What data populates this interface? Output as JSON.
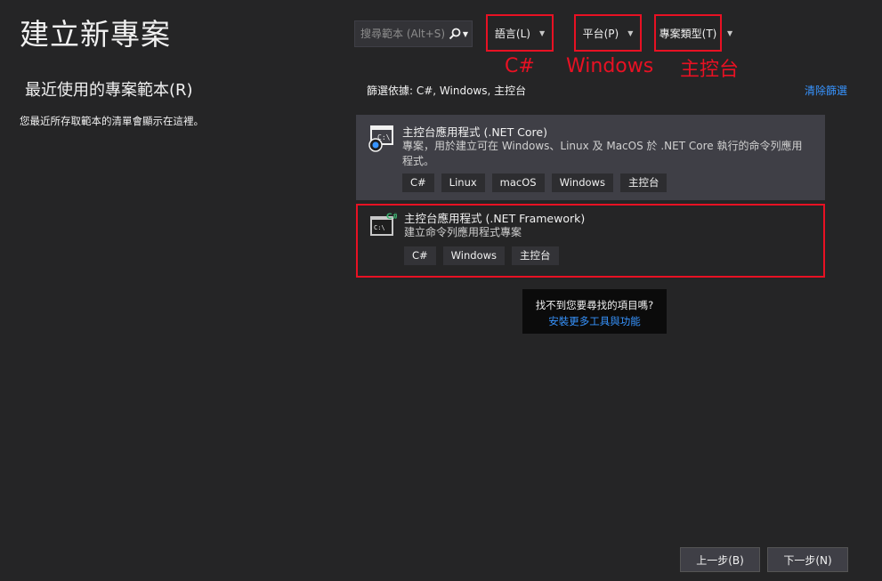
{
  "header": {
    "title": "建立新專案"
  },
  "recent": {
    "title": "最近使用的專案範本(R)",
    "empty_message": "您最近所存取範本的清單會顯示在這裡。"
  },
  "search": {
    "placeholder": "搜尋範本 (Alt+S)"
  },
  "filters": {
    "language": {
      "label": "語言(L)",
      "annotation": "C#"
    },
    "platform": {
      "label": "平台(P)",
      "annotation": "Windows"
    },
    "project_type": {
      "label": "專案類型(T)",
      "annotation": "主控台"
    },
    "applied_text": "篩選依據: C#, Windows, 主控台",
    "clear_label": "清除篩選"
  },
  "templates": [
    {
      "title": "主控台應用程式 (.NET Core)",
      "description": "專案，用於建立可在 Windows、Linux 及 MacOS 於 .NET Core 執行的命令列應用程式。",
      "tags": [
        "C#",
        "Linux",
        "macOS",
        "Windows",
        "主控台"
      ],
      "icon": "console-dotnet-core-icon"
    },
    {
      "title": "主控台應用程式 (.NET Framework)",
      "description": "建立命令列應用程式專案",
      "tags": [
        "C#",
        "Windows",
        "主控台"
      ],
      "icon": "console-csharp-icon"
    }
  ],
  "not_found": {
    "question": "找不到您要尋找的項目嗎?",
    "link": "安裝更多工具與功能"
  },
  "footer": {
    "back_label": "上一步(B)",
    "next_label": "下一步(N)"
  },
  "colors": {
    "background": "#252526",
    "accent_link": "#3794ff",
    "annotation_red": "#e81123"
  }
}
